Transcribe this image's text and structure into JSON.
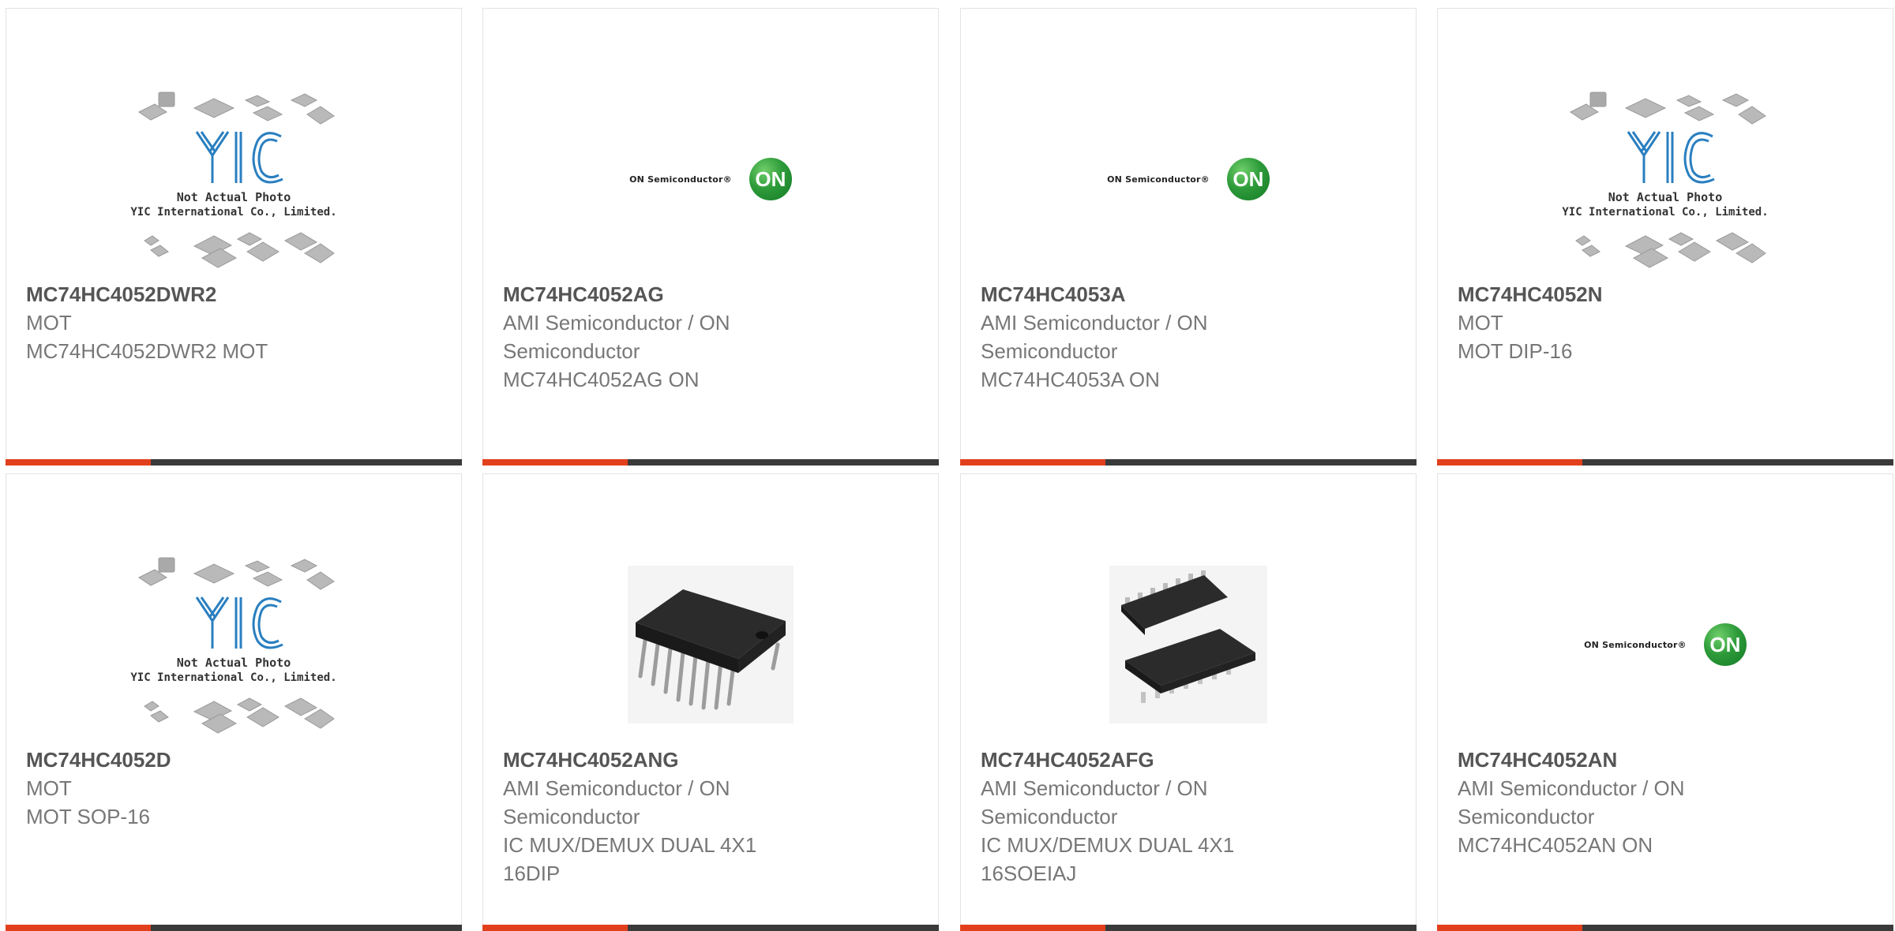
{
  "products": [
    {
      "part": "MC74HC4052DWR2",
      "lines": [
        "MOT",
        "MC74HC4052DWR2 MOT"
      ],
      "image": "yic-placeholder"
    },
    {
      "part": "MC74HC4052AG",
      "lines": [
        "AMI Semiconductor / ON",
        "Semiconductor",
        "MC74HC4052AG ON"
      ],
      "image": "on-semiconductor-logo"
    },
    {
      "part": "MC74HC4053A",
      "lines": [
        "AMI Semiconductor / ON",
        "Semiconductor",
        "MC74HC4053A ON"
      ],
      "image": "on-semiconductor-logo"
    },
    {
      "part": "MC74HC4052N",
      "lines": [
        "MOT",
        "MOT DIP-16"
      ],
      "image": "yic-placeholder"
    },
    {
      "part": "MC74HC4052D",
      "lines": [
        "MOT",
        "MOT SOP-16"
      ],
      "image": "yic-placeholder"
    },
    {
      "part": "MC74HC4052ANG",
      "lines": [
        "AMI Semiconductor / ON",
        "Semiconductor",
        "IC MUX/DEMUX DUAL 4X1",
        "16DIP"
      ],
      "image": "dip-chip-photo"
    },
    {
      "part": "MC74HC4052AFG",
      "lines": [
        "AMI Semiconductor / ON",
        "Semiconductor",
        "IC MUX/DEMUX DUAL 4X1",
        "16SOEIAJ"
      ],
      "image": "soic-chip-photo"
    },
    {
      "part": "MC74HC4052AN",
      "lines": [
        "AMI Semiconductor / ON",
        "Semiconductor",
        "MC74HC4052AN ON"
      ],
      "image": "on-semiconductor-logo"
    }
  ],
  "yic": {
    "brand": "YIC",
    "caption1": "Not Actual Photo",
    "caption2": "YIC International Co., Limited."
  },
  "on_logo": {
    "wordmark": "ON Semiconductor®",
    "badge": "ON"
  },
  "colors": {
    "accent": "#e2401c",
    "bar": "#3a3a3a",
    "on_green": "#2e9b3a",
    "yic_blue": "#2a7fc0"
  }
}
